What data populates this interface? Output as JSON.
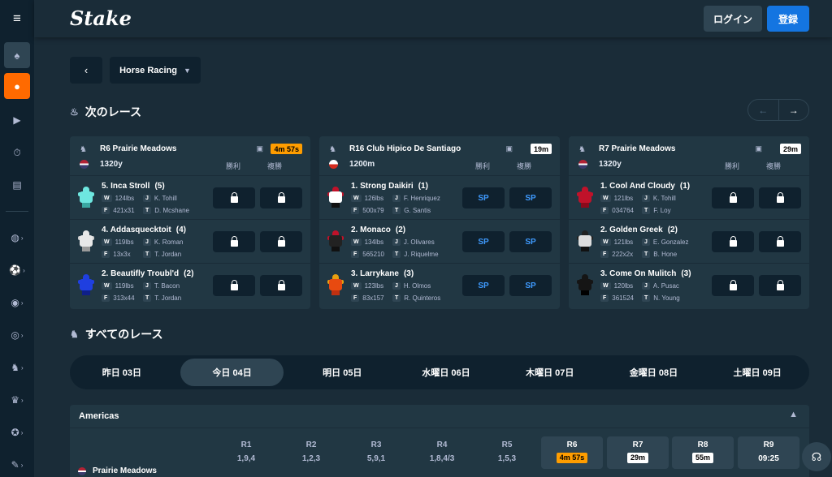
{
  "header": {
    "logo": "Stake",
    "login_label": "ログイン",
    "register_label": "登録"
  },
  "nav": {
    "back": "‹",
    "sport_select": "Horse Racing"
  },
  "sections": {
    "next_races": "次のレース",
    "all_races": "すべてのレース"
  },
  "cards": [
    {
      "race": "R6 Prairie Meadows",
      "timer": "4m 57s",
      "timer_style": "urgent",
      "distance": "1320y",
      "flag": "us",
      "col1": "勝利",
      "col2": "複勝",
      "runners": [
        {
          "name": "5. Inca Stroll",
          "pp": "(5)",
          "w": "124lbs",
          "j": "K. Tohill",
          "f": "421x31",
          "t": "D. Mcshane",
          "odds": [
            "lock",
            "lock"
          ],
          "silk": [
            "#6ee7e0",
            "#6ee7e0",
            "#6ee7e0",
            "#3aa8a2"
          ]
        },
        {
          "name": "4. Addasquecktoit",
          "pp": "(4)",
          "w": "119lbs",
          "j": "K. Roman",
          "f": "13x3x",
          "t": "T. Jordan",
          "odds": [
            "lock",
            "lock"
          ],
          "silk": [
            "#e8e8e8",
            "#e8e8e8",
            "#cfcfcf",
            "#9a9a9a"
          ]
        },
        {
          "name": "2. Beautifly Troubl'd",
          "pp": "(2)",
          "w": "119lbs",
          "j": "T. Bacon",
          "f": "313x44",
          "t": "T. Jordan",
          "odds": [
            "lock",
            "lock"
          ],
          "silk": [
            "#1f3fe0",
            "#1f3fe0",
            "#1f3fe0",
            "#0f1f88"
          ]
        }
      ]
    },
    {
      "race": "R16 Club Hipico De Santiago",
      "timer": "19m",
      "timer_style": "normal",
      "distance": "1200m",
      "flag": "cl",
      "col1": "勝利",
      "col2": "複勝",
      "runners": [
        {
          "name": "1. Strong Daikiri",
          "pp": "(1)",
          "w": "126lbs",
          "j": "F. Henriquez",
          "f": "500x79",
          "t": "G. Santis",
          "odds": [
            "SP",
            "SP"
          ],
          "silk": [
            "#c0122a",
            "#ffffff",
            "#c0122a",
            "#111111"
          ]
        },
        {
          "name": "2. Monaco",
          "pp": "(2)",
          "w": "134lbs",
          "j": "J. Olivares",
          "f": "565210",
          "t": "J. Riquelme",
          "odds": [
            "SP",
            "SP"
          ],
          "silk": [
            "#c0122a",
            "#222222",
            "#c0122a",
            "#111111"
          ]
        },
        {
          "name": "3. Larrykane",
          "pp": "(3)",
          "w": "123lbs",
          "j": "H. Olmos",
          "f": "83x157",
          "t": "R. Quinteros",
          "odds": [
            "SP",
            "SP"
          ],
          "silk": [
            "#e8a010",
            "#e84a10",
            "#e8a010",
            "#c03010"
          ]
        }
      ]
    },
    {
      "race": "R7 Prairie Meadows",
      "timer": "29m",
      "timer_style": "normal",
      "distance": "1320y",
      "flag": "us",
      "col1": "勝利",
      "col2": "複勝",
      "runners": [
        {
          "name": "1. Cool And Cloudy",
          "pp": "(1)",
          "w": "121lbs",
          "j": "K. Tohill",
          "f": "034764",
          "t": "F. Loy",
          "odds": [
            "lock",
            "lock"
          ],
          "silk": [
            "#c0122a",
            "#c0122a",
            "#c0122a",
            "#8a0a1c"
          ]
        },
        {
          "name": "2. Golden Greek",
          "pp": "(2)",
          "w": "121lbs",
          "j": "E. Gonzalez",
          "f": "222x2x",
          "t": "B. Hone",
          "odds": [
            "lock",
            "lock"
          ],
          "silk": [
            "#222222",
            "#dddddd",
            "#222222",
            "#111111"
          ]
        },
        {
          "name": "3. Come On Mulitch",
          "pp": "(3)",
          "w": "120lbs",
          "j": "A. Pusac",
          "f": "361524",
          "t": "N. Young",
          "odds": [
            "lock",
            "lock"
          ],
          "silk": [
            "#151515",
            "#151515",
            "#151515",
            "#000000"
          ]
        }
      ]
    }
  ],
  "days": [
    {
      "label": "昨日 03日",
      "active": false
    },
    {
      "label": "今日 04日",
      "active": true
    },
    {
      "label": "明日 05日",
      "active": false
    },
    {
      "label": "水曜日 06日",
      "active": false
    },
    {
      "label": "木曜日 07日",
      "active": false
    },
    {
      "label": "金曜日 08日",
      "active": false
    },
    {
      "label": "土曜日 09日",
      "active": false
    }
  ],
  "region": {
    "name": "Americas",
    "track": "Prairie Meadows",
    "races": [
      {
        "r": "R1",
        "v": "1,9,4"
      },
      {
        "r": "R2",
        "v": "1,2,3"
      },
      {
        "r": "R3",
        "v": "5,9,1"
      },
      {
        "r": "R4",
        "v": "1,8,4/3"
      },
      {
        "r": "R5",
        "v": "1,5,3"
      },
      {
        "r": "R6",
        "tag": "4m 57s",
        "tag_style": "urgent"
      },
      {
        "r": "R7",
        "tag": "29m",
        "tag_style": "normal"
      },
      {
        "r": "R8",
        "tag": "55m",
        "tag_style": "normal"
      },
      {
        "r": "R9",
        "v": "09:25"
      }
    ]
  },
  "stat_keys": {
    "w": "W",
    "j": "J",
    "f": "F",
    "t": "T"
  },
  "colors": {
    "accent": "#1475e1",
    "sports_active": "#ff6a00",
    "urgent": "#ff9d00",
    "sp": "#3f9bff"
  }
}
